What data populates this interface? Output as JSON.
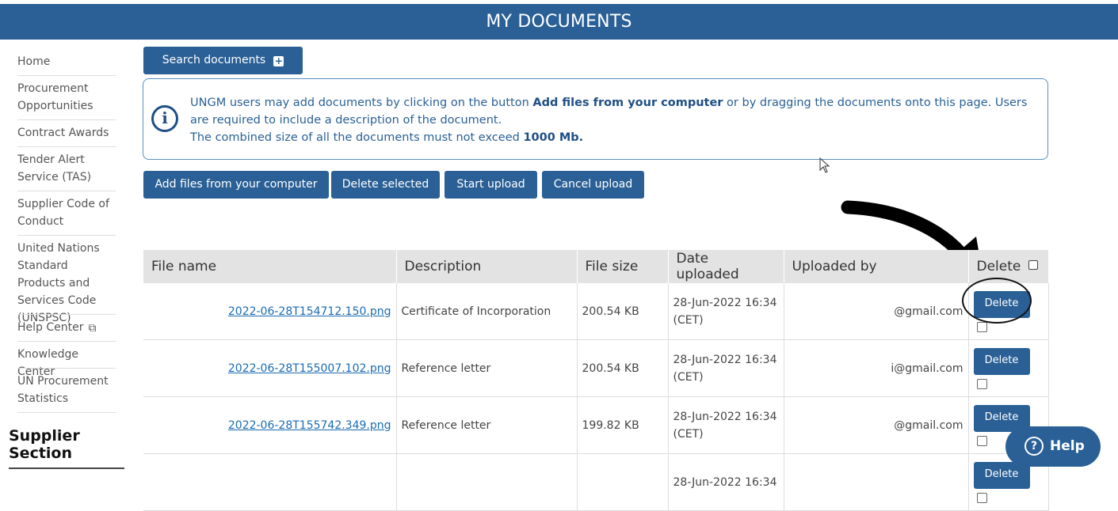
{
  "header": {
    "title": "MY DOCUMENTS"
  },
  "sidebar": {
    "items": [
      {
        "label": "Home"
      },
      {
        "label": "Procurement Opportunities"
      },
      {
        "label": "Contract Awards"
      },
      {
        "label": "Tender Alert Service (TAS)"
      },
      {
        "label": "Supplier Code of Conduct"
      },
      {
        "label": "United Nations Standard Products and Services Code (UNSPSC)"
      },
      {
        "label": "Help Center"
      },
      {
        "label": "Knowledge Center"
      },
      {
        "label": "UN Procurement Statistics"
      }
    ],
    "section_title": "Supplier Section"
  },
  "search": {
    "label": "Search documents"
  },
  "info": {
    "text1": "UNGM users may add documents by clicking on the button ",
    "bold1": "Add files from your computer",
    "text2": " or by dragging the documents onto this page. Users are required to include a description of the document.",
    "text3": "The combined size of all the documents must not exceed ",
    "bold2": "1000 Mb."
  },
  "toolbar": {
    "add_files": "Add files from your computer",
    "delete_selected": "Delete selected",
    "start_upload": "Start upload",
    "cancel_upload": "Cancel upload"
  },
  "table": {
    "headers": [
      "File name",
      "Description",
      "File size",
      "Date uploaded",
      "Uploaded by",
      "Delete"
    ],
    "rows": [
      {
        "file": "2022-06-28T154712.150.png",
        "description": "Certificate of Incorporation",
        "size": "200.54 KB",
        "date": "28-Jun-2022 16:34",
        "tz": "(CET)",
        "by": "@gmail.com",
        "delete": "Delete"
      },
      {
        "file": "2022-06-28T155007.102.png",
        "description": "Reference letter",
        "size": "200.54 KB",
        "date": "28-Jun-2022 16:34",
        "tz": "(CET)",
        "by": "i@gmail.com",
        "delete": "Delete"
      },
      {
        "file": "2022-06-28T155742.349.png",
        "description": "Reference letter",
        "size": "199.82 KB",
        "date": "28-Jun-2022 16:34",
        "tz": "(CET)",
        "by": "@gmail.com",
        "delete": "Delete"
      },
      {
        "file": "",
        "description": "",
        "size": "",
        "date": "28-Jun-2022 16:34",
        "tz": "",
        "by": "",
        "delete": "Delete"
      }
    ]
  },
  "help": {
    "label": "Help"
  }
}
